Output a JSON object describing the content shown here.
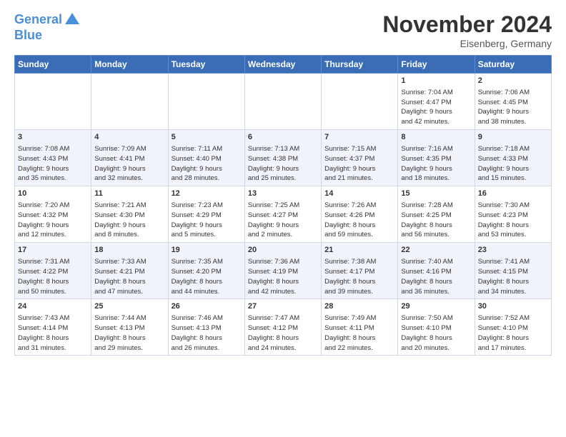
{
  "logo": {
    "line1": "General",
    "line2": "Blue"
  },
  "title": "November 2024",
  "location": "Eisenberg, Germany",
  "headers": [
    "Sunday",
    "Monday",
    "Tuesday",
    "Wednesday",
    "Thursday",
    "Friday",
    "Saturday"
  ],
  "weeks": [
    [
      {
        "day": "",
        "info": ""
      },
      {
        "day": "",
        "info": ""
      },
      {
        "day": "",
        "info": ""
      },
      {
        "day": "",
        "info": ""
      },
      {
        "day": "",
        "info": ""
      },
      {
        "day": "1",
        "info": "Sunrise: 7:04 AM\nSunset: 4:47 PM\nDaylight: 9 hours\nand 42 minutes."
      },
      {
        "day": "2",
        "info": "Sunrise: 7:06 AM\nSunset: 4:45 PM\nDaylight: 9 hours\nand 38 minutes."
      }
    ],
    [
      {
        "day": "3",
        "info": "Sunrise: 7:08 AM\nSunset: 4:43 PM\nDaylight: 9 hours\nand 35 minutes."
      },
      {
        "day": "4",
        "info": "Sunrise: 7:09 AM\nSunset: 4:41 PM\nDaylight: 9 hours\nand 32 minutes."
      },
      {
        "day": "5",
        "info": "Sunrise: 7:11 AM\nSunset: 4:40 PM\nDaylight: 9 hours\nand 28 minutes."
      },
      {
        "day": "6",
        "info": "Sunrise: 7:13 AM\nSunset: 4:38 PM\nDaylight: 9 hours\nand 25 minutes."
      },
      {
        "day": "7",
        "info": "Sunrise: 7:15 AM\nSunset: 4:37 PM\nDaylight: 9 hours\nand 21 minutes."
      },
      {
        "day": "8",
        "info": "Sunrise: 7:16 AM\nSunset: 4:35 PM\nDaylight: 9 hours\nand 18 minutes."
      },
      {
        "day": "9",
        "info": "Sunrise: 7:18 AM\nSunset: 4:33 PM\nDaylight: 9 hours\nand 15 minutes."
      }
    ],
    [
      {
        "day": "10",
        "info": "Sunrise: 7:20 AM\nSunset: 4:32 PM\nDaylight: 9 hours\nand 12 minutes."
      },
      {
        "day": "11",
        "info": "Sunrise: 7:21 AM\nSunset: 4:30 PM\nDaylight: 9 hours\nand 8 minutes."
      },
      {
        "day": "12",
        "info": "Sunrise: 7:23 AM\nSunset: 4:29 PM\nDaylight: 9 hours\nand 5 minutes."
      },
      {
        "day": "13",
        "info": "Sunrise: 7:25 AM\nSunset: 4:27 PM\nDaylight: 9 hours\nand 2 minutes."
      },
      {
        "day": "14",
        "info": "Sunrise: 7:26 AM\nSunset: 4:26 PM\nDaylight: 8 hours\nand 59 minutes."
      },
      {
        "day": "15",
        "info": "Sunrise: 7:28 AM\nSunset: 4:25 PM\nDaylight: 8 hours\nand 56 minutes."
      },
      {
        "day": "16",
        "info": "Sunrise: 7:30 AM\nSunset: 4:23 PM\nDaylight: 8 hours\nand 53 minutes."
      }
    ],
    [
      {
        "day": "17",
        "info": "Sunrise: 7:31 AM\nSunset: 4:22 PM\nDaylight: 8 hours\nand 50 minutes."
      },
      {
        "day": "18",
        "info": "Sunrise: 7:33 AM\nSunset: 4:21 PM\nDaylight: 8 hours\nand 47 minutes."
      },
      {
        "day": "19",
        "info": "Sunrise: 7:35 AM\nSunset: 4:20 PM\nDaylight: 8 hours\nand 44 minutes."
      },
      {
        "day": "20",
        "info": "Sunrise: 7:36 AM\nSunset: 4:19 PM\nDaylight: 8 hours\nand 42 minutes."
      },
      {
        "day": "21",
        "info": "Sunrise: 7:38 AM\nSunset: 4:17 PM\nDaylight: 8 hours\nand 39 minutes."
      },
      {
        "day": "22",
        "info": "Sunrise: 7:40 AM\nSunset: 4:16 PM\nDaylight: 8 hours\nand 36 minutes."
      },
      {
        "day": "23",
        "info": "Sunrise: 7:41 AM\nSunset: 4:15 PM\nDaylight: 8 hours\nand 34 minutes."
      }
    ],
    [
      {
        "day": "24",
        "info": "Sunrise: 7:43 AM\nSunset: 4:14 PM\nDaylight: 8 hours\nand 31 minutes."
      },
      {
        "day": "25",
        "info": "Sunrise: 7:44 AM\nSunset: 4:13 PM\nDaylight: 8 hours\nand 29 minutes."
      },
      {
        "day": "26",
        "info": "Sunrise: 7:46 AM\nSunset: 4:13 PM\nDaylight: 8 hours\nand 26 minutes."
      },
      {
        "day": "27",
        "info": "Sunrise: 7:47 AM\nSunset: 4:12 PM\nDaylight: 8 hours\nand 24 minutes."
      },
      {
        "day": "28",
        "info": "Sunrise: 7:49 AM\nSunset: 4:11 PM\nDaylight: 8 hours\nand 22 minutes."
      },
      {
        "day": "29",
        "info": "Sunrise: 7:50 AM\nSunset: 4:10 PM\nDaylight: 8 hours\nand 20 minutes."
      },
      {
        "day": "30",
        "info": "Sunrise: 7:52 AM\nSunset: 4:10 PM\nDaylight: 8 hours\nand 17 minutes."
      }
    ]
  ]
}
